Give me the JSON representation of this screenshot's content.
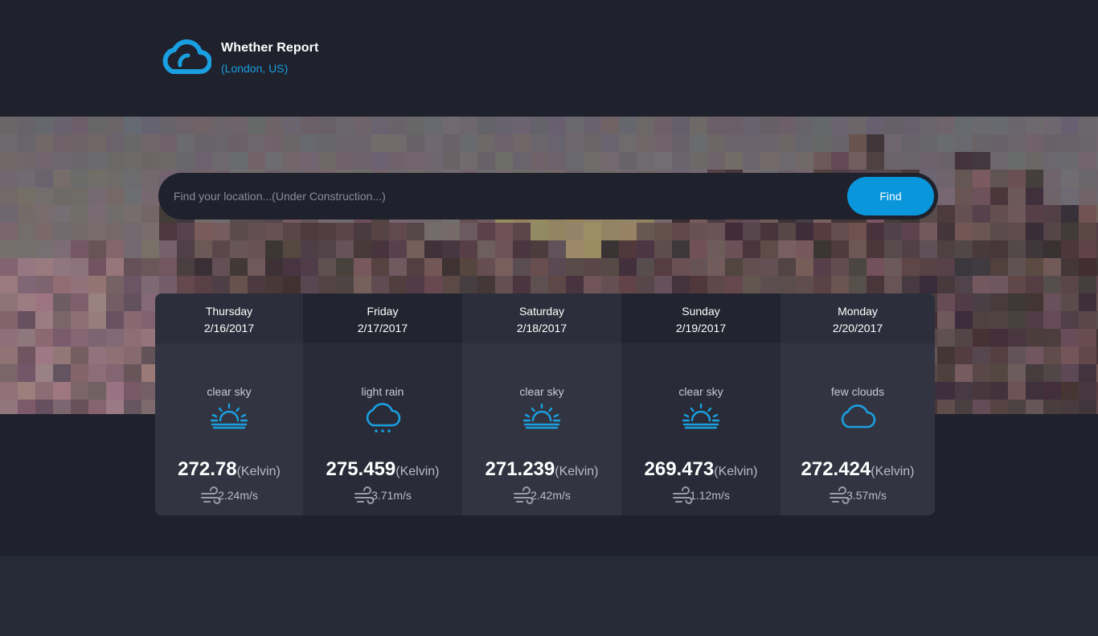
{
  "header": {
    "title": "Whether Report",
    "location": "(London, US)",
    "logo_icon": "cloud-icon"
  },
  "search": {
    "placeholder": "Find your location...(Under Construction...)",
    "value": "",
    "button_label": "Find"
  },
  "colors": {
    "accent": "#0a96db",
    "icon_blue": "#1a9fe0",
    "page_bg": "#1f212d"
  },
  "forecast": [
    {
      "day": "Thursday",
      "date": "2/16/2017",
      "description": "clear sky",
      "icon": "sunrise-icon",
      "temp": "272.78",
      "unit": "(Kelvin)",
      "wind": "2.24m/s"
    },
    {
      "day": "Friday",
      "date": "2/17/2017",
      "description": "light rain",
      "icon": "rain-cloud-icon",
      "temp": "275.459",
      "unit": "(Kelvin)",
      "wind": "3.71m/s"
    },
    {
      "day": "Saturday",
      "date": "2/18/2017",
      "description": "clear sky",
      "icon": "sunrise-icon",
      "temp": "271.239",
      "unit": "(Kelvin)",
      "wind": "2.42m/s"
    },
    {
      "day": "Sunday",
      "date": "2/19/2017",
      "description": "clear sky",
      "icon": "sunrise-icon",
      "temp": "269.473",
      "unit": "(Kelvin)",
      "wind": "1.12m/s"
    },
    {
      "day": "Monday",
      "date": "2/20/2017",
      "description": "few clouds",
      "icon": "cloud-icon",
      "temp": "272.424",
      "unit": "(Kelvin)",
      "wind": "3.57m/s"
    }
  ]
}
